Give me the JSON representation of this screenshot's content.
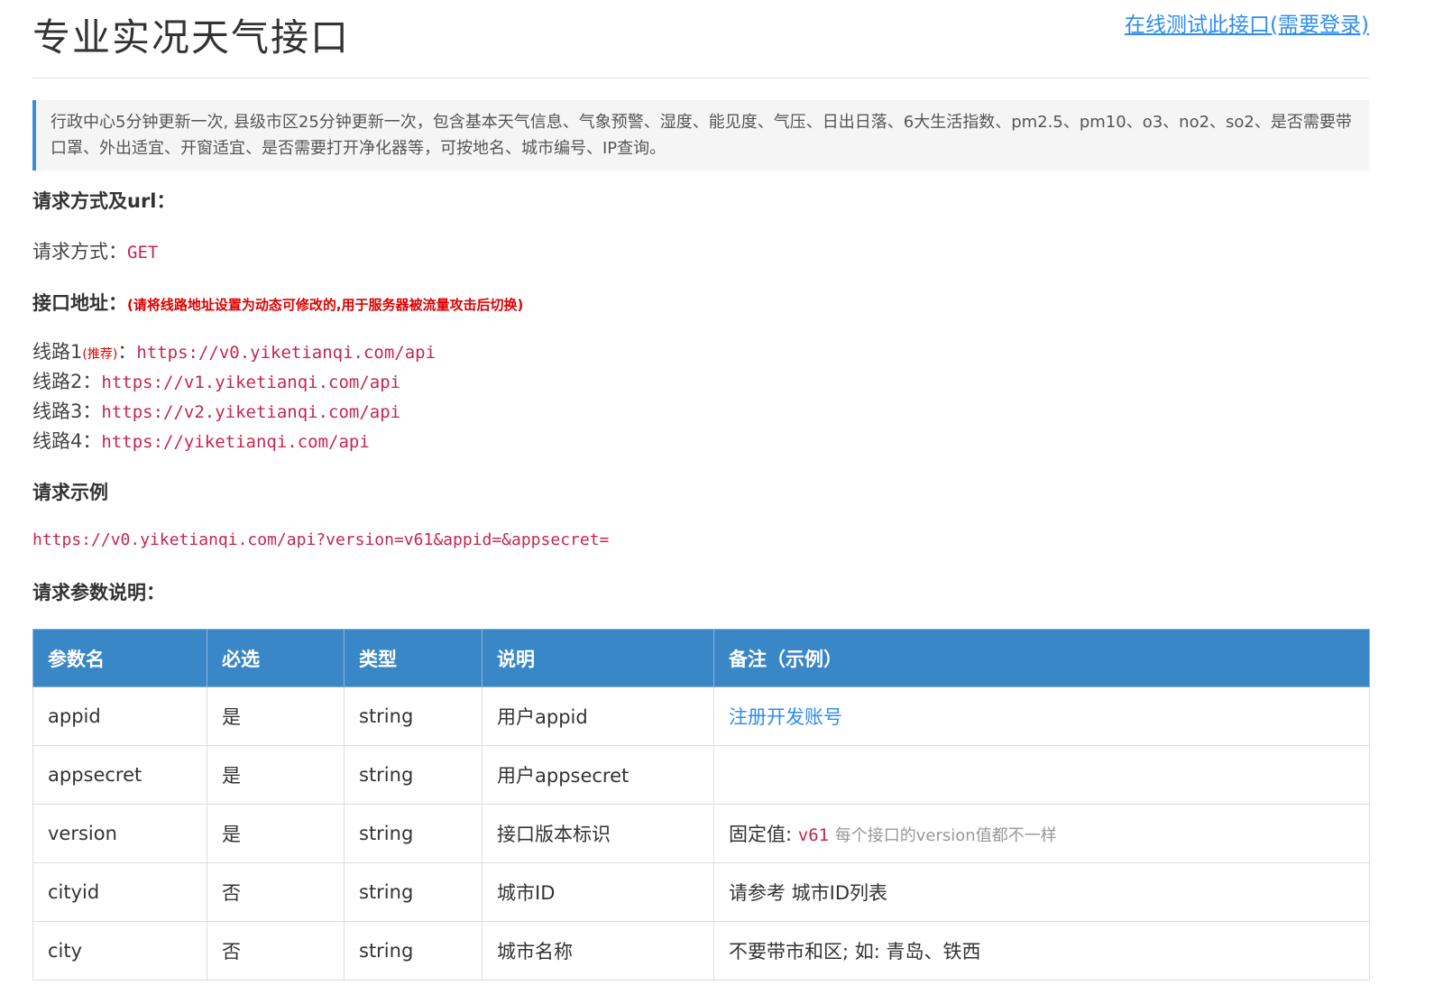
{
  "header": {
    "title": "专业实况天气接口",
    "test_link": "在线测试此接口(需要登录)"
  },
  "description": "行政中心5分钟更新一次, 县级市区25分钟更新一次，包含基本天气信息、气象预警、湿度、能见度、气压、日出日落、6大生活指数、pm2.5、pm10、o3、no2、so2、是否需要带口罩、外出适宜、开窗适宜、是否需要打开净化器等，可按地名、城市编号、IP查询。",
  "request": {
    "heading": "请求方式及url：",
    "method_label": "请求方式：",
    "method_value": "GET",
    "address_label": "接口地址：",
    "address_notice": "(请将线路地址设置为动态可修改的,用于服务器被流量攻击后切换)",
    "routes": [
      {
        "label": "线路1",
        "tag": "(推荐)",
        "sep": "：",
        "url": "https://v0.yiketianqi.com/api"
      },
      {
        "label": "线路2",
        "tag": "",
        "sep": "：",
        "url": "https://v1.yiketianqi.com/api"
      },
      {
        "label": "线路3",
        "tag": "",
        "sep": "：",
        "url": "https://v2.yiketianqi.com/api"
      },
      {
        "label": "线路4",
        "tag": "",
        "sep": "：",
        "url": "https://yiketianqi.com/api"
      }
    ]
  },
  "example": {
    "heading": "请求示例",
    "url": "https://v0.yiketianqi.com/api?version=v61&appid=&appsecret="
  },
  "params": {
    "heading": "请求参数说明：",
    "columns": [
      "参数名",
      "必选",
      "类型",
      "说明",
      "备注（示例）"
    ],
    "rows": [
      {
        "name": "appid",
        "required": "是",
        "type": "string",
        "desc": "用户appid",
        "remark_link": "注册开发账号"
      },
      {
        "name": "appsecret",
        "required": "是",
        "type": "string",
        "desc": "用户appsecret"
      },
      {
        "name": "version",
        "required": "是",
        "type": "string",
        "desc": "接口版本标识",
        "remark_prefix": "固定值: ",
        "remark_code": "v61",
        "remark_note": "每个接口的version值都不一样"
      },
      {
        "name": "cityid",
        "required": "否",
        "type": "string",
        "desc": "城市ID",
        "remark": "请参考 城市ID列表"
      },
      {
        "name": "city",
        "required": "否",
        "type": "string",
        "desc": "城市名称",
        "remark": "不要带市和区; 如: 青岛、铁西"
      }
    ]
  }
}
